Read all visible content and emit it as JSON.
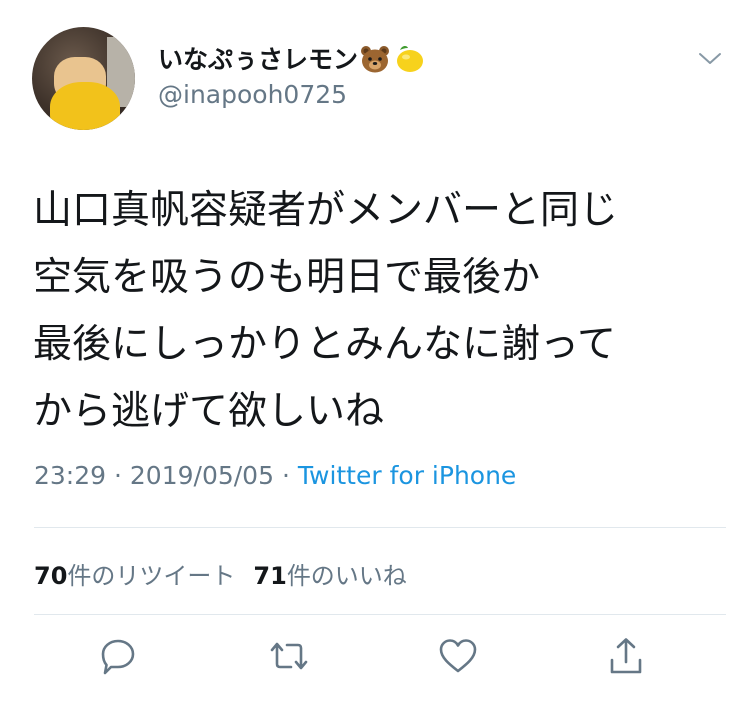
{
  "tweet": {
    "display_name": "いなぷぅさレモン",
    "display_name_emojis": [
      "bear-face-emoji",
      "lemon-emoji"
    ],
    "handle": "@inapooh0725",
    "text_lines": [
      "山口真帆容疑者がメンバーと同じ",
      "空気を吸うのも明日で最後か",
      "最後にしっかりとみんなに謝って",
      "から逃げて欲しいね"
    ],
    "time": "23:29",
    "date": "2019/05/05",
    "separator": "·",
    "source": "Twitter for iPhone",
    "retweet_count": "70",
    "retweet_label": "件のリツイート",
    "like_count": "71",
    "like_label": "件のいいね"
  },
  "icons": {
    "more": "chevron-down-icon",
    "reply": "reply-icon",
    "retweet": "retweet-icon",
    "like": "heart-icon",
    "share": "share-icon"
  },
  "colors": {
    "text": "#14171a",
    "secondary": "#657786",
    "link": "#1b95e0",
    "divider": "#e1e8ed",
    "icon": "#657786"
  }
}
